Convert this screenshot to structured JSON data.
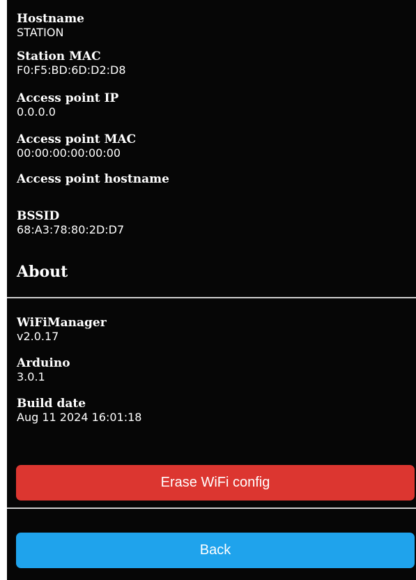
{
  "info": {
    "hostname_label": "Hostname",
    "hostname_value": "STATION",
    "station_mac_label": "Station MAC",
    "station_mac_value": "F0:F5:BD:6D:D2:D8",
    "ap_ip_label": "Access point IP",
    "ap_ip_value": "0.0.0.0",
    "ap_mac_label": "Access point MAC",
    "ap_mac_value": "00:00:00:00:00:00",
    "ap_hostname_label": "Access point hostname",
    "ap_hostname_value": "",
    "bssid_label": "BSSID",
    "bssid_value": "68:A3:78:80:2D:D7"
  },
  "about": {
    "heading": "About",
    "wifimanager_label": "WiFiManager",
    "wifimanager_value": "v2.0.17",
    "arduino_label": "Arduino",
    "arduino_value": "3.0.1",
    "build_date_label": "Build date",
    "build_date_value": "Aug 11 2024 16:01:18"
  },
  "actions": {
    "erase_label": "Erase WiFi config",
    "back_label": "Back"
  },
  "colors": {
    "background": "#060606",
    "erase_button": "#dc3630",
    "back_button": "#1fa3ec",
    "divider": "#cfcfcf"
  }
}
